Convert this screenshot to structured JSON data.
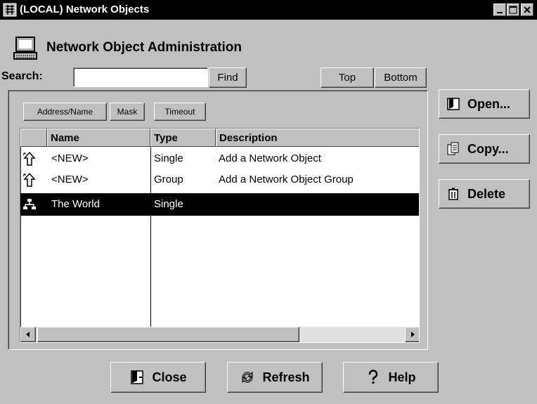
{
  "window": {
    "title": "(LOCAL) Network Objects"
  },
  "header": {
    "title": "Network Object Administration"
  },
  "search": {
    "label": "Search:",
    "value": "",
    "find_label": "Find",
    "top_label": "Top",
    "bottom_label": "Bottom"
  },
  "filters": {
    "address_name": "Address/Name",
    "mask": "Mask",
    "timeout": "Timeout"
  },
  "table": {
    "columns": [
      "",
      "Name",
      "Type",
      "Description"
    ],
    "rows": [
      {
        "icon": "new-object-icon",
        "name": "<NEW>",
        "type": "Single",
        "description": "Add a Network Object",
        "selected": false
      },
      {
        "icon": "new-object-icon",
        "name": "<NEW>",
        "type": "Group",
        "description": "Add a Network Object Group",
        "selected": false
      },
      {
        "icon": "network-icon",
        "name": "The World",
        "type": "Single",
        "description": "",
        "selected": true
      }
    ]
  },
  "actions": {
    "open": "Open...",
    "copy": "Copy...",
    "delete": "Delete"
  },
  "footer": {
    "close": "Close",
    "refresh": "Refresh",
    "help": "Help"
  }
}
